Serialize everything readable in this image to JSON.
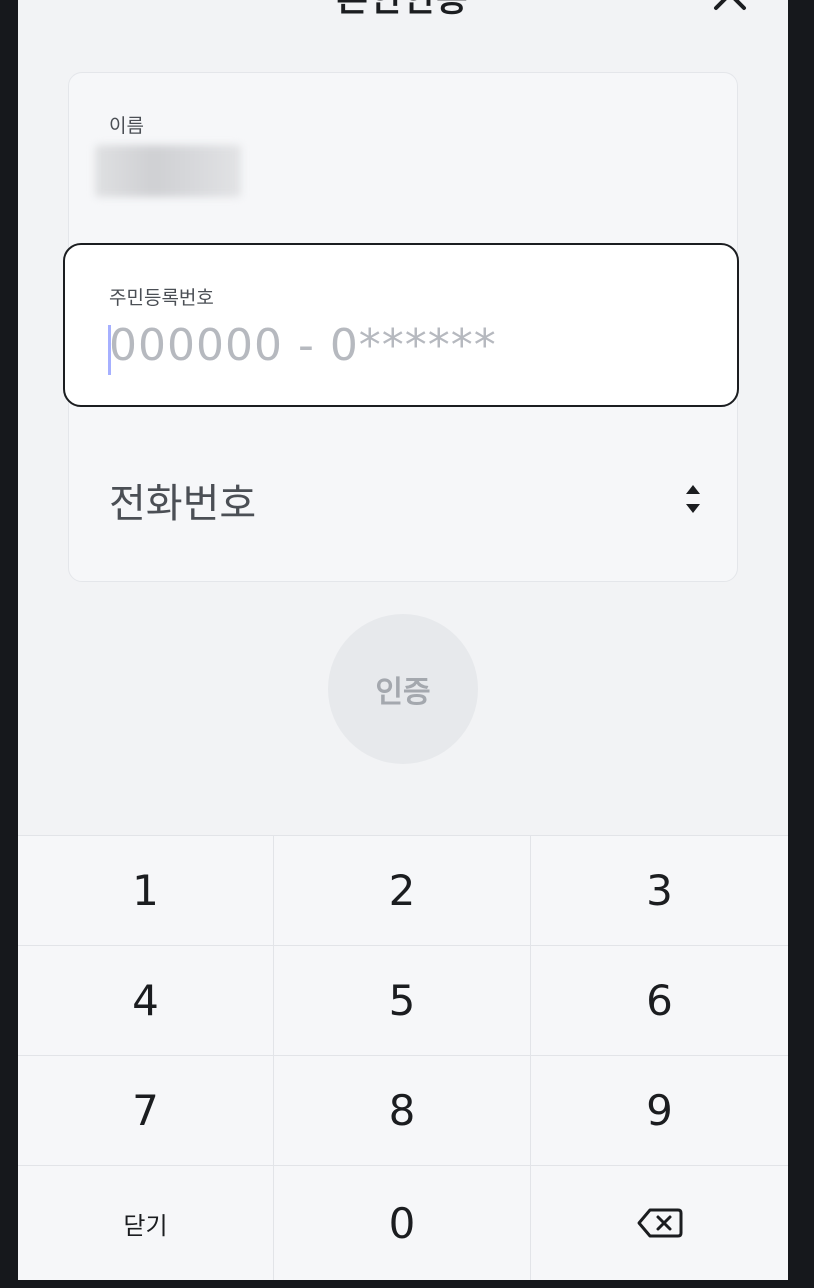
{
  "header": {
    "title": "본인인증"
  },
  "form": {
    "name_label": "이름",
    "rrn_label": "주민등록번호",
    "rrn_placeholder": "000000 - 0******",
    "phone_label": "전화번호"
  },
  "auth_button": {
    "label": "인증"
  },
  "keypad": {
    "k1": "1",
    "k2": "2",
    "k3": "3",
    "k4": "4",
    "k5": "5",
    "k6": "6",
    "k7": "7",
    "k8": "8",
    "k9": "9",
    "close": "닫기",
    "k0": "0",
    "backspace_icon": "backspace-icon"
  },
  "colors": {
    "accent_caret": "#6b7bff",
    "field_border": "#1b1d20"
  }
}
